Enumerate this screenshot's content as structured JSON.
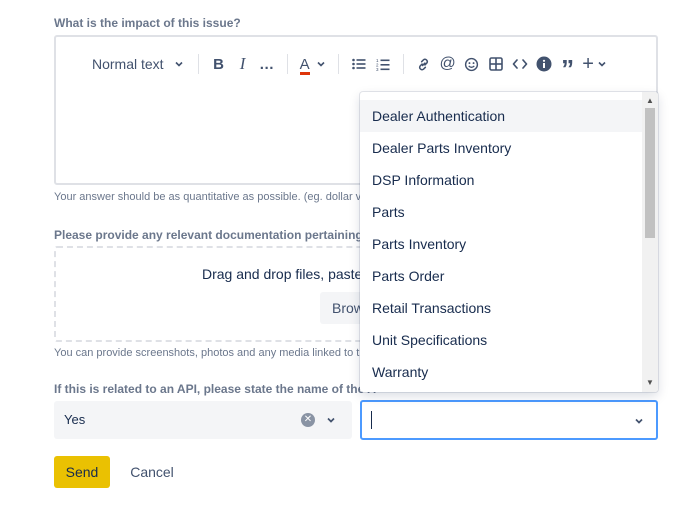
{
  "impact": {
    "label": "What is the impact of this issue?",
    "help": "Your answer should be as quantitative as possible. (eg. dollar v"
  },
  "editor": {
    "text_style": "Normal text",
    "bold": "B",
    "italic": "I",
    "more": "…",
    "text_color": "A",
    "quote": "”",
    "plus": "+"
  },
  "documentation": {
    "label": "Please provide any relevant documentation pertaining to",
    "dropzone_text": "Drag and drop files, paste",
    "browse_label": "Brow",
    "help": "You can provide screenshots, photos and any media linked to t"
  },
  "api": {
    "label": "If this is related to an API, please state the name of the A",
    "related_value": "Yes",
    "api_value": ""
  },
  "menu": {
    "items": [
      "Dealer Authentication",
      "Dealer Parts Inventory",
      "DSP Information",
      "Parts",
      "Parts Inventory",
      "Parts Order",
      "Retail Transactions",
      "Unit Specifications",
      "Warranty"
    ],
    "highlighted": "Dealer Authentication"
  },
  "actions": {
    "send_label": "Send",
    "cancel_label": "Cancel"
  },
  "colors": {
    "primary_button": "#eac102",
    "focus_border": "#4c9aff",
    "label_text": "#6b778c"
  }
}
